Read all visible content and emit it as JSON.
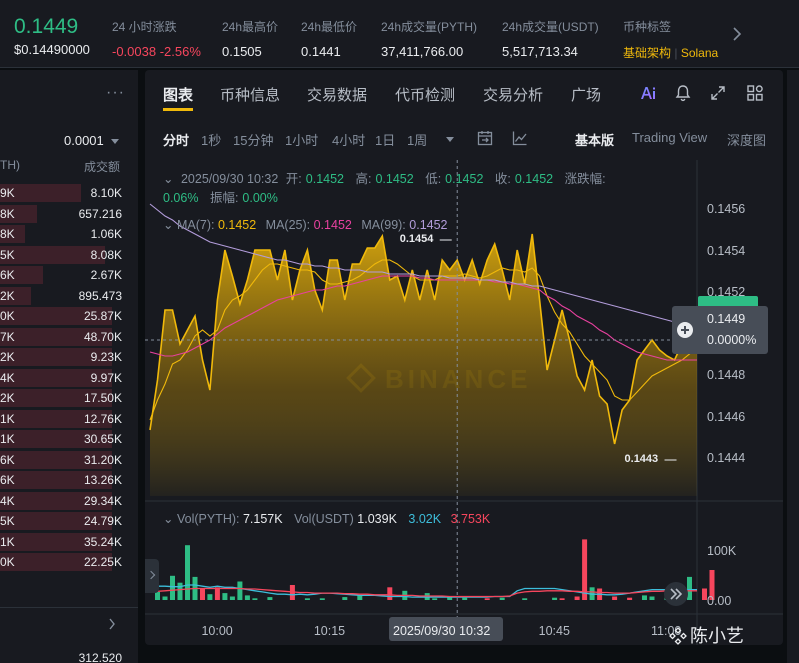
{
  "ticker": {
    "last_price": "0.1449",
    "usd_price": "$0.14490000",
    "change_label": "24 小时涨跌",
    "change_value": "-0.0038 -2.56%",
    "high_label": "24h最高价",
    "high_value": "0.1505",
    "low_label": "24h最低价",
    "low_value": "0.1441",
    "vol_base_label": "24h成交量(PYTH)",
    "vol_base_value": "37,411,766.00",
    "vol_quote_label": "24h成交量(USDT)",
    "vol_quote_value": "5,517,713.34",
    "tags_label": "币种标签",
    "tag_1": "基础架构",
    "tag_sep": "|",
    "tag_2": "Solana"
  },
  "orderbook": {
    "more": "···",
    "precision": "0.0001",
    "col_price_partial": "TH)",
    "col_amount": "成交额",
    "rows": [
      {
        "a": "9K",
        "b": "8.10K",
        "depth": 0.65
      },
      {
        "a": "8K",
        "b": "657.216",
        "depth": 0.3
      },
      {
        "a": "8K",
        "b": "1.06K",
        "depth": 0.2
      },
      {
        "a": "5K",
        "b": "8.08K",
        "depth": 0.85
      },
      {
        "a": "6K",
        "b": "2.67K",
        "depth": 0.35
      },
      {
        "a": "2K",
        "b": "895.473",
        "depth": 0.25
      },
      {
        "a": "0K",
        "b": "25.87K",
        "depth": 0.9
      },
      {
        "a": "7K",
        "b": "48.70K",
        "depth": 0.9
      },
      {
        "a": "2K",
        "b": "9.23K",
        "depth": 0.9
      },
      {
        "a": "4K",
        "b": "9.97K",
        "depth": 0.9
      },
      {
        "a": "2K",
        "b": "17.50K",
        "depth": 0.9
      },
      {
        "a": "1K",
        "b": "12.76K",
        "depth": 0.9
      },
      {
        "a": "1K",
        "b": "30.65K",
        "depth": 0.9
      },
      {
        "a": "6K",
        "b": "31.20K",
        "depth": 0.9
      },
      {
        "a": "6K",
        "b": "13.26K",
        "depth": 0.9
      },
      {
        "a": "4K",
        "b": "29.34K",
        "depth": 0.9
      },
      {
        "a": "5K",
        "b": "24.79K",
        "depth": 0.9
      },
      {
        "a": "1K",
        "b": "35.24K",
        "depth": 0.9
      },
      {
        "a": "0K",
        "b": "22.25K",
        "depth": 0.9
      }
    ],
    "bottom_value": "312.520"
  },
  "tabs": [
    "图表",
    "币种信息",
    "交易数据",
    "代币检测",
    "交易分析",
    "广场"
  ],
  "toolbar": {
    "intervals": [
      "分时",
      "1秒",
      "15分钟",
      "1小时",
      "4小时",
      "1日",
      "1周"
    ],
    "views": [
      "基本版",
      "Trading View",
      "深度图"
    ]
  },
  "legend": {
    "datetime": "2025/09/30 10:32",
    "open_label": "开:",
    "open": "0.1452",
    "high_label": "高:",
    "high": "0.1452",
    "low_label": "低:",
    "low": "0.1452",
    "close_label": "收:",
    "close": "0.1452",
    "chg_label": "涨跌幅:",
    "chg": "0.06%",
    "amp_label": "振幅:",
    "amp": "0.00%",
    "ma7_label": "MA(7):",
    "ma7": "0.1452",
    "ma25_label": "MA(25):",
    "ma25": "0.1452",
    "ma99_label": "MA(99):",
    "ma99": "0.1452",
    "vol_label": "Vol(PYTH):",
    "vol": "7.157K",
    "volq_label": "Vol(USDT)",
    "volq": "1.039K",
    "volma1": "3.02K",
    "volma2": "3.753K"
  },
  "price_tag": {
    "price": "0.1449",
    "pct": "0.0000%"
  },
  "watermark": "陈小艺",
  "colors": {
    "up": "#2ebd85",
    "down": "#f6465d",
    "accent": "#f0b90b",
    "ma25": "#e8419f",
    "ma99": "#b39ddb",
    "volma": "#3dbedb"
  },
  "chart_data": {
    "type": "area",
    "y_ticks": [
      "0.1456",
      "0.1454",
      "0.1452",
      "0.1449",
      "0.1448",
      "0.1446",
      "0.1444"
    ],
    "ylim": [
      0.14415,
      0.14575
    ],
    "x_ticks": [
      "10:00",
      "10:15",
      "10:32",
      "10:45",
      "11:00"
    ],
    "x_tick_minutes": [
      0,
      15,
      32,
      45,
      60
    ],
    "crosshair_label": "2025/09/30 10:32",
    "crosshair_minute": 32,
    "high_annotation": {
      "label": "0.1454",
      "minute": 31,
      "value": 0.1454
    },
    "low_annotation": {
      "label": "0.1443",
      "minute": 61,
      "value": 0.1443
    },
    "x_minutes": [
      -9,
      -8,
      -7,
      -6,
      -5,
      -4,
      -3,
      -2,
      -1,
      0,
      1,
      2,
      3,
      4,
      5,
      6,
      7,
      8,
      9,
      10,
      11,
      12,
      13,
      14,
      15,
      16,
      17,
      18,
      19,
      20,
      21,
      22,
      23,
      24,
      25,
      26,
      27,
      28,
      29,
      30,
      31,
      32,
      33,
      34,
      35,
      36,
      37,
      38,
      39,
      40,
      41,
      42,
      43,
      44,
      45,
      46,
      47,
      48,
      49,
      50,
      51,
      52,
      53,
      54,
      55,
      56,
      57,
      58,
      59,
      60,
      61,
      62,
      63,
      64
    ],
    "series": [
      {
        "values": [
          0.14445,
          0.1447,
          0.14505,
          0.14505,
          0.14488,
          0.14495,
          0.14502,
          0.1448,
          0.14465,
          0.1451,
          0.14535,
          0.14522,
          0.14508,
          0.1452,
          0.14535,
          0.14535,
          0.14535,
          0.1452,
          0.14535,
          0.1451,
          0.14525,
          0.14535,
          0.14515,
          0.14505,
          0.1453,
          0.1453,
          0.1451,
          0.14528,
          0.14528,
          0.14536,
          0.14536,
          0.14542,
          0.1452,
          0.14522,
          0.1451,
          0.14525,
          0.1451,
          0.14525,
          0.1451,
          0.1453,
          0.14525,
          0.1453,
          0.1452,
          0.1453,
          0.14518,
          0.1453,
          0.14538,
          0.14525,
          0.1451,
          0.14535,
          0.14518,
          0.14543,
          0.1451,
          0.14475,
          0.1449,
          0.14505,
          0.1449,
          0.14472,
          0.14465,
          0.1448,
          0.14462,
          0.14458,
          0.14438,
          0.14455,
          0.1446,
          0.1448,
          0.14485,
          0.1449,
          0.14485,
          0.14482,
          0.1448,
          0.14488,
          0.1449,
          0.14495
        ]
      },
      {
        "name": "MA(7)",
        "values": [
          0.1445,
          0.1446,
          0.14468,
          0.14478,
          0.1448,
          0.14485,
          0.14492,
          0.14495,
          0.14492,
          0.14495,
          0.14505,
          0.1451,
          0.14512,
          0.14515,
          0.1452,
          0.14525,
          0.14528,
          0.14528,
          0.14527,
          0.14526,
          0.14525,
          0.14525,
          0.14524,
          0.1452,
          0.14518,
          0.14518,
          0.14519,
          0.1452,
          0.14522,
          0.14525,
          0.14528,
          0.1453,
          0.1453,
          0.14528,
          0.14525,
          0.14522,
          0.1452,
          0.1452,
          0.1452,
          0.14522,
          0.14522,
          0.14522,
          0.14523,
          0.14522,
          0.14521,
          0.14522,
          0.14524,
          0.14526,
          0.14525,
          0.14525,
          0.14524,
          0.14526,
          0.14522,
          0.14512,
          0.14504,
          0.14498,
          0.14494,
          0.14488,
          0.14482,
          0.14478,
          0.14474,
          0.1447,
          0.14462,
          0.1446,
          0.1446,
          0.14464,
          0.14468,
          0.14472,
          0.14474,
          0.14476,
          0.14478,
          0.1448,
          0.14483,
          0.14486
        ]
      },
      {
        "name": "MA(25)",
        "values": [
          0.14484,
          0.14483,
          0.14482,
          0.14482,
          0.14483,
          0.14484,
          0.14486,
          0.14488,
          0.1449,
          0.14493,
          0.14496,
          0.14498,
          0.145,
          0.14502,
          0.14504,
          0.14506,
          0.14508,
          0.1451,
          0.14511,
          0.14512,
          0.14513,
          0.14514,
          0.14515,
          0.14515,
          0.14516,
          0.14517,
          0.14517,
          0.14518,
          0.14519,
          0.1452,
          0.14521,
          0.14522,
          0.14522,
          0.14522,
          0.14522,
          0.14522,
          0.14521,
          0.14521,
          0.1452,
          0.1452,
          0.1452,
          0.1452,
          0.1452,
          0.1452,
          0.1452,
          0.1452,
          0.14519,
          0.14519,
          0.14518,
          0.14518,
          0.14517,
          0.14516,
          0.14515,
          0.14512,
          0.1451,
          0.14507,
          0.14505,
          0.14502,
          0.145,
          0.14498,
          0.14495,
          0.14493,
          0.1449,
          0.14488,
          0.14486,
          0.14484,
          0.14483,
          0.14482,
          0.14481,
          0.1448,
          0.1448,
          0.1448,
          0.1448,
          0.1448
        ]
      },
      {
        "name": "MA(99)",
        "values": [
          0.14558,
          0.14555,
          0.14552,
          0.1455,
          0.14547,
          0.14545,
          0.14543,
          0.14541,
          0.14539,
          0.14538,
          0.14537,
          0.14536,
          0.14535,
          0.14534,
          0.14533,
          0.14532,
          0.14531,
          0.1453,
          0.1453,
          0.14529,
          0.14528,
          0.14528,
          0.14527,
          0.14527,
          0.14526,
          0.14526,
          0.14525,
          0.14525,
          0.14525,
          0.14524,
          0.14524,
          0.14524,
          0.14523,
          0.14523,
          0.14523,
          0.14523,
          0.14522,
          0.14522,
          0.14522,
          0.14522,
          0.14521,
          0.14521,
          0.14521,
          0.14521,
          0.1452,
          0.1452,
          0.1452,
          0.14519,
          0.14519,
          0.14518,
          0.14518,
          0.14517,
          0.14517,
          0.14516,
          0.14515,
          0.14514,
          0.14513,
          0.14512,
          0.14511,
          0.1451,
          0.14509,
          0.14508,
          0.14507,
          0.14506,
          0.14505,
          0.14504,
          0.14503,
          0.14502,
          0.14501,
          0.145,
          0.14499,
          0.14498,
          0.14497,
          0.14496
        ]
      }
    ],
    "volume": {
      "y_ticks": [
        "100K",
        "0.00"
      ],
      "ylim": [
        0,
        130000
      ],
      "bars": [
        {
          "m": -8,
          "v": 14000,
          "up": true
        },
        {
          "m": -7,
          "v": 6000,
          "up": true
        },
        {
          "m": -6,
          "v": 42000,
          "up": true
        },
        {
          "m": -5,
          "v": 30000,
          "up": true
        },
        {
          "m": -4,
          "v": 95000,
          "up": true
        },
        {
          "m": -3,
          "v": 40000,
          "up": true
        },
        {
          "m": -2,
          "v": 20000,
          "up": false
        },
        {
          "m": -1,
          "v": 10000,
          "up": true
        },
        {
          "m": 0,
          "v": 22000,
          "up": false
        },
        {
          "m": 1,
          "v": 12000,
          "up": true
        },
        {
          "m": 2,
          "v": 6000,
          "up": true
        },
        {
          "m": 3,
          "v": 32000,
          "up": true
        },
        {
          "m": 4,
          "v": 8000,
          "up": true
        },
        {
          "m": 5,
          "v": 3000,
          "up": true
        },
        {
          "m": 7,
          "v": 5000,
          "up": true
        },
        {
          "m": 10,
          "v": 26000,
          "up": false
        },
        {
          "m": 12,
          "v": 3000,
          "up": true
        },
        {
          "m": 14,
          "v": 3000,
          "up": true
        },
        {
          "m": 17,
          "v": 5000,
          "up": true
        },
        {
          "m": 19,
          "v": 8000,
          "up": true
        },
        {
          "m": 23,
          "v": 22000,
          "up": false
        },
        {
          "m": 25,
          "v": 16000,
          "up": true
        },
        {
          "m": 28,
          "v": 12000,
          "up": true
        },
        {
          "m": 29,
          "v": 3000,
          "up": true
        },
        {
          "m": 31,
          "v": 5000,
          "up": true
        },
        {
          "m": 33,
          "v": 4000,
          "up": true
        },
        {
          "m": 36,
          "v": 3000,
          "up": false
        },
        {
          "m": 38,
          "v": 4000,
          "up": true
        },
        {
          "m": 41,
          "v": 3000,
          "up": true
        },
        {
          "m": 45,
          "v": 4000,
          "up": true
        },
        {
          "m": 46,
          "v": 3000,
          "up": false
        },
        {
          "m": 48,
          "v": 6000,
          "up": false
        },
        {
          "m": 49,
          "v": 105000,
          "up": false
        },
        {
          "m": 50,
          "v": 22000,
          "up": true
        },
        {
          "m": 51,
          "v": 20000,
          "up": false
        },
        {
          "m": 53,
          "v": 6000,
          "up": false
        },
        {
          "m": 55,
          "v": 4000,
          "up": false
        },
        {
          "m": 57,
          "v": 8000,
          "up": true
        },
        {
          "m": 58,
          "v": 6000,
          "up": true
        },
        {
          "m": 60,
          "v": 6000,
          "up": true
        },
        {
          "m": 62,
          "v": 5000,
          "up": true
        },
        {
          "m": 63,
          "v": 40000,
          "up": true
        },
        {
          "m": 65,
          "v": 20000,
          "up": false
        },
        {
          "m": 66,
          "v": 52000,
          "up": false
        }
      ],
      "ma1": [
        22000,
        24000,
        24000,
        23000,
        23000,
        26000,
        26000,
        24000,
        22000,
        24000,
        22000,
        22000,
        20000,
        18000,
        16000,
        14000,
        12000,
        10000,
        10000,
        9000,
        10000,
        9000,
        10000,
        12000,
        12000,
        11000,
        10000,
        9000,
        8000,
        8000,
        8000,
        7000,
        6000,
        6000,
        6000,
        5000,
        5000,
        5000,
        5000,
        5000,
        5000,
        5000,
        5000,
        5000,
        5000,
        5000,
        6000,
        6000,
        6000,
        16000,
        20000,
        20000,
        20000,
        20000,
        20000,
        18000,
        16000,
        14000,
        12000,
        10000,
        10000,
        9000,
        9000,
        10000,
        12000,
        14000,
        16000,
        18000,
        18000,
        18000,
        18000,
        18000,
        18000,
        18000
      ],
      "ma2": [
        14000,
        15000,
        16000,
        17000,
        18000,
        19000,
        20000,
        20000,
        20000,
        20000,
        20000,
        20000,
        20000,
        19000,
        19000,
        18000,
        17000,
        16000,
        15000,
        14000,
        13000,
        13000,
        12000,
        12000,
        12000,
        12000,
        11000,
        11000,
        10000,
        10000,
        9000,
        9000,
        9000,
        8000,
        8000,
        8000,
        7000,
        7000,
        7000,
        7000,
        6000,
        6000,
        6000,
        6000,
        6000,
        6000,
        6000,
        6000,
        7000,
        12000,
        14000,
        15000,
        15000,
        16000,
        16000,
        16000,
        15000,
        15000,
        14000,
        14000,
        13000,
        13000,
        12000,
        12000,
        12000,
        13000,
        14000,
        15000,
        15000,
        16000,
        16000,
        16000,
        16000,
        16000
      ]
    }
  }
}
